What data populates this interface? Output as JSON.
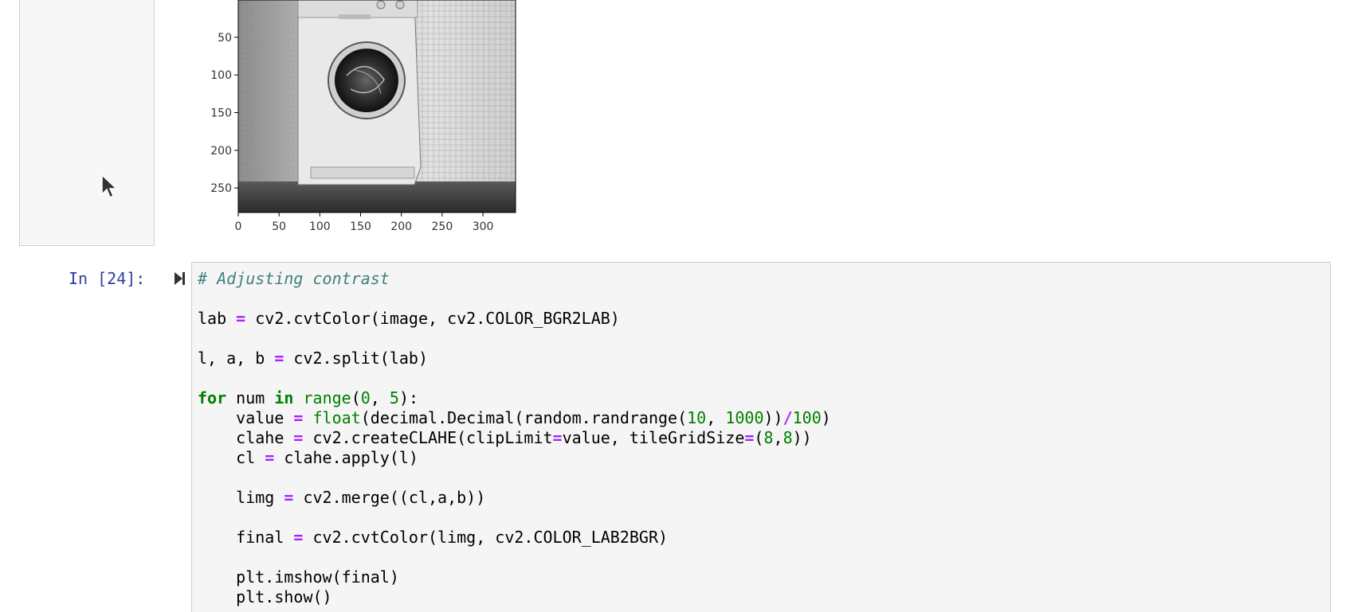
{
  "figure": {
    "y_ticks": [
      "50",
      "100",
      "150",
      "200",
      "250"
    ],
    "x_ticks": [
      "0",
      "50",
      "100",
      "150",
      "200",
      "250",
      "300"
    ],
    "image_subject": "washing-machine"
  },
  "cell": {
    "prompt": "In [24]:",
    "lines": [
      [
        {
          "t": "comment",
          "v": "# Adjusting contrast"
        }
      ],
      [],
      [
        {
          "t": "plain",
          "v": "lab "
        },
        {
          "t": "op",
          "v": "="
        },
        {
          "t": "plain",
          "v": " cv2.cvtColor(image, cv2.COLOR_BGR2LAB)"
        }
      ],
      [],
      [
        {
          "t": "plain",
          "v": "l, a, b "
        },
        {
          "t": "op",
          "v": "="
        },
        {
          "t": "plain",
          "v": " cv2.split(lab)"
        }
      ],
      [],
      [
        {
          "t": "kw",
          "v": "for"
        },
        {
          "t": "plain",
          "v": " num "
        },
        {
          "t": "kw",
          "v": "in"
        },
        {
          "t": "plain",
          "v": " "
        },
        {
          "t": "builtin",
          "v": "range"
        },
        {
          "t": "plain",
          "v": "("
        },
        {
          "t": "num",
          "v": "0"
        },
        {
          "t": "plain",
          "v": ", "
        },
        {
          "t": "num",
          "v": "5"
        },
        {
          "t": "plain",
          "v": "):"
        }
      ],
      [
        {
          "t": "plain",
          "v": "    value "
        },
        {
          "t": "op",
          "v": "="
        },
        {
          "t": "plain",
          "v": " "
        },
        {
          "t": "builtin",
          "v": "float"
        },
        {
          "t": "plain",
          "v": "(decimal.Decimal(random.randrange("
        },
        {
          "t": "num",
          "v": "10"
        },
        {
          "t": "plain",
          "v": ", "
        },
        {
          "t": "num",
          "v": "1000"
        },
        {
          "t": "plain",
          "v": "))"
        },
        {
          "t": "op",
          "v": "/"
        },
        {
          "t": "num",
          "v": "100"
        },
        {
          "t": "plain",
          "v": ")"
        }
      ],
      [
        {
          "t": "plain",
          "v": "    clahe "
        },
        {
          "t": "op",
          "v": "="
        },
        {
          "t": "plain",
          "v": " cv2.createCLAHE(clipLimit"
        },
        {
          "t": "op",
          "v": "="
        },
        {
          "t": "plain",
          "v": "value, tileGridSize"
        },
        {
          "t": "op",
          "v": "="
        },
        {
          "t": "plain",
          "v": "("
        },
        {
          "t": "num",
          "v": "8"
        },
        {
          "t": "plain",
          "v": ","
        },
        {
          "t": "num",
          "v": "8"
        },
        {
          "t": "plain",
          "v": "))"
        }
      ],
      [
        {
          "t": "plain",
          "v": "    cl "
        },
        {
          "t": "op",
          "v": "="
        },
        {
          "t": "plain",
          "v": " clahe.apply(l)"
        }
      ],
      [],
      [
        {
          "t": "plain",
          "v": "    limg "
        },
        {
          "t": "op",
          "v": "="
        },
        {
          "t": "plain",
          "v": " cv2.merge((cl,a,b))"
        }
      ],
      [],
      [
        {
          "t": "plain",
          "v": "    final "
        },
        {
          "t": "op",
          "v": "="
        },
        {
          "t": "plain",
          "v": " cv2.cvtColor(limg, cv2.COLOR_LAB2BGR)"
        }
      ],
      [],
      [
        {
          "t": "plain",
          "v": "    plt.imshow(final)"
        }
      ],
      [
        {
          "t": "plain",
          "v": "    plt.show()"
        }
      ]
    ]
  },
  "icons": {
    "run": "run-cell-icon",
    "cursor": "mouse-pointer-icon"
  }
}
